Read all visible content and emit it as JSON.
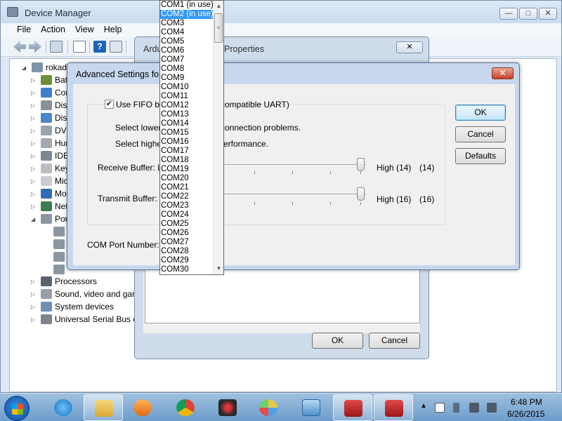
{
  "device_manager": {
    "title": "Device Manager",
    "menu": [
      "File",
      "Action",
      "View",
      "Help"
    ],
    "tree": [
      {
        "label": "rokade",
        "expanded": true
      },
      {
        "label": "Bat"
      },
      {
        "label": "Cor"
      },
      {
        "label": "Disl"
      },
      {
        "label": "Disp"
      },
      {
        "label": "DVD"
      },
      {
        "label": "Hur"
      },
      {
        "label": "IDE"
      },
      {
        "label": "Key"
      },
      {
        "label": "Mic"
      },
      {
        "label": "Mo"
      },
      {
        "label": "Net"
      },
      {
        "label": "Por",
        "expanded": true
      },
      {
        "label": ""
      },
      {
        "label": ""
      },
      {
        "label": ""
      },
      {
        "label": ""
      },
      {
        "label": "Processors"
      },
      {
        "label": "Sound, video and gan"
      },
      {
        "label": "System devices"
      },
      {
        "label": "Universal Serial Bus co"
      }
    ]
  },
  "properties_dialog": {
    "title_left": "Ardu",
    "title_right": "Properties",
    "close": "✕",
    "ok": "OK",
    "cancel": "Cancel"
  },
  "advanced_dialog": {
    "title": "Advanced Settings for",
    "close": "✕",
    "fifo_checked": true,
    "fifo_label_left": "Use FIFO buf",
    "fifo_label_right": "compatible UART)",
    "hint_lower_left": "Select lower s",
    "hint_lower_right": "connection problems.",
    "hint_higher_left": "Select higher",
    "hint_higher_right": "erformance.",
    "receive_label": "Receive Buffer:  L",
    "receive_value_label": "High (14)",
    "receive_value": "(14)",
    "transmit_label": "Transmit Buffer:  L",
    "transmit_value_label": "High (16)",
    "transmit_value": "(16)",
    "com_port_label": "COM Port Number:",
    "ok": "OK",
    "cancel": "Cancel",
    "defaults": "Defaults"
  },
  "com_dropdown": {
    "selected": "COM2 (in use)",
    "items": [
      "COM1 (in use)",
      "COM2 (in use)",
      "COM3",
      "COM4",
      "COM5",
      "COM6",
      "COM7",
      "COM8",
      "COM9",
      "COM10",
      "COM11",
      "COM12",
      "COM13",
      "COM14",
      "COM15",
      "COM16",
      "COM17",
      "COM18",
      "COM19",
      "COM20",
      "COM21",
      "COM22",
      "COM23",
      "COM24",
      "COM25",
      "COM26",
      "COM27",
      "COM28",
      "COM29",
      "COM30"
    ]
  },
  "taskbar": {
    "time": "6:48 PM",
    "date": "6/26/2015",
    "apps": [
      "internet-explorer",
      "file-explorer",
      "media-player",
      "chrome",
      "app-red-grid",
      "paint",
      "control-panel",
      "toolbox-1",
      "toolbox-2"
    ]
  }
}
